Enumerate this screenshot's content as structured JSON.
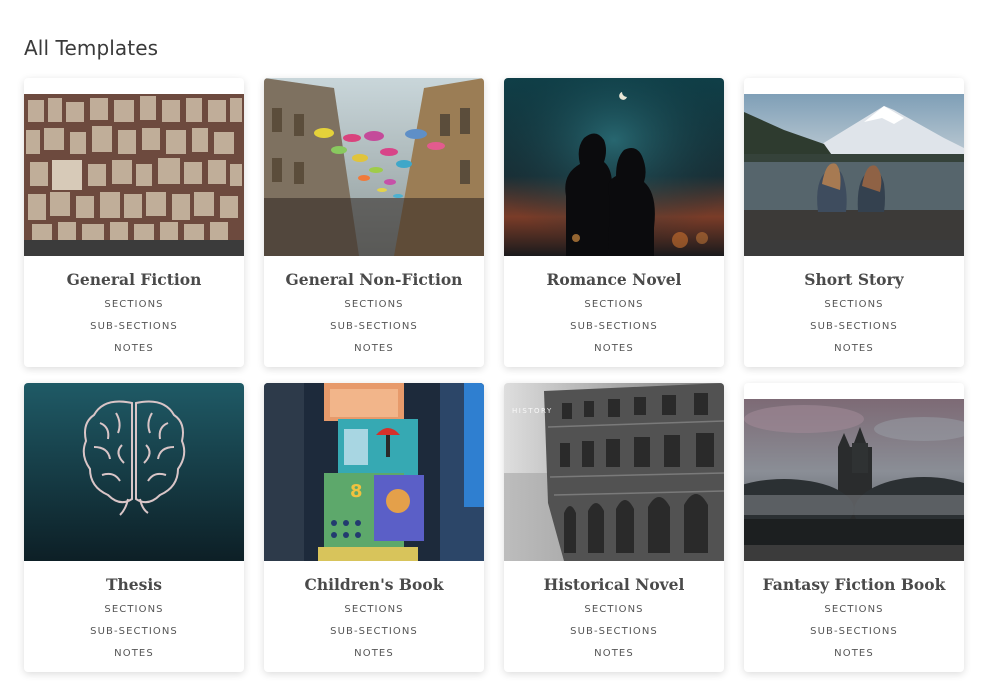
{
  "page": {
    "title": "All Templates"
  },
  "templates": [
    {
      "title": "General Fiction",
      "image": "open-books-wall-image",
      "meta": [
        "SECTIONS",
        "SUB-SECTIONS",
        "NOTES"
      ]
    },
    {
      "title": "General Non-Fiction",
      "image": "umbrella-street-image",
      "meta": [
        "SECTIONS",
        "SUB-SECTIONS",
        "NOTES"
      ]
    },
    {
      "title": "Romance Novel",
      "image": "couple-silhouette-image",
      "meta": [
        "SECTIONS",
        "SUB-SECTIONS",
        "NOTES"
      ]
    },
    {
      "title": "Short Story",
      "image": "lake-mountain-image",
      "meta": [
        "SECTIONS",
        "SUB-SECTIONS",
        "NOTES"
      ]
    },
    {
      "title": "Thesis",
      "image": "brain-illustration-image",
      "meta": [
        "SECTIONS",
        "SUB-SECTIONS",
        "NOTES"
      ]
    },
    {
      "title": "Children's Book",
      "image": "toy-blocks-image",
      "meta": [
        "SECTIONS",
        "SUB-SECTIONS",
        "NOTES"
      ]
    },
    {
      "title": "Historical Novel",
      "image": "colosseum-image",
      "image_text": "HISTORY",
      "meta": [
        "SECTIONS",
        "SUB-SECTIONS",
        "NOTES"
      ]
    },
    {
      "title": "Fantasy Fiction Book",
      "image": "castle-in-fog-image",
      "meta": [
        "SECTIONS",
        "SUB-SECTIONS",
        "NOTES"
      ]
    }
  ]
}
